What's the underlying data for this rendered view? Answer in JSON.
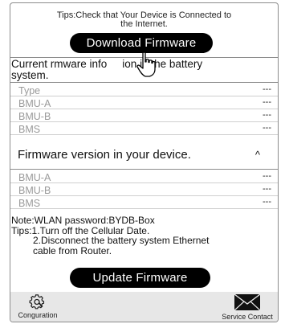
{
  "tips_top": {
    "line1": "Tips:Check that Your Device is Connected to",
    "line2": "the Internet."
  },
  "download_button": "Download Firmware",
  "current_info": {
    "line1": "Current rmware info",
    "line1b": "ion in the battery",
    "line2": "system."
  },
  "current_rows": [
    {
      "label": "Type",
      "value": "---"
    },
    {
      "label": "BMU-A",
      "value": "---"
    },
    {
      "label": "BMU-B",
      "value": "---"
    },
    {
      "label": "BMS",
      "value": "---"
    }
  ],
  "device_section": {
    "title": "Firmware version in your device.",
    "caret": "^"
  },
  "device_rows": [
    {
      "label": "BMU-A",
      "value": "---"
    },
    {
      "label": "BMU-B",
      "value": "---"
    },
    {
      "label": "BMS",
      "value": "---"
    }
  ],
  "note": {
    "line1": "Note:WLAN password:BYDB-Box",
    "line2": "Tips:1.Turn off the Cellular Date.",
    "line3": "2.Disconnect the battery system Ethernet",
    "line4": "cable from Router."
  },
  "update_button": "Update Firmware",
  "bottom_nav": {
    "left_label": "Conguration",
    "left_icon": "gear-icon",
    "right_label": "Service Contact",
    "right_icon": "envelope-icon"
  }
}
